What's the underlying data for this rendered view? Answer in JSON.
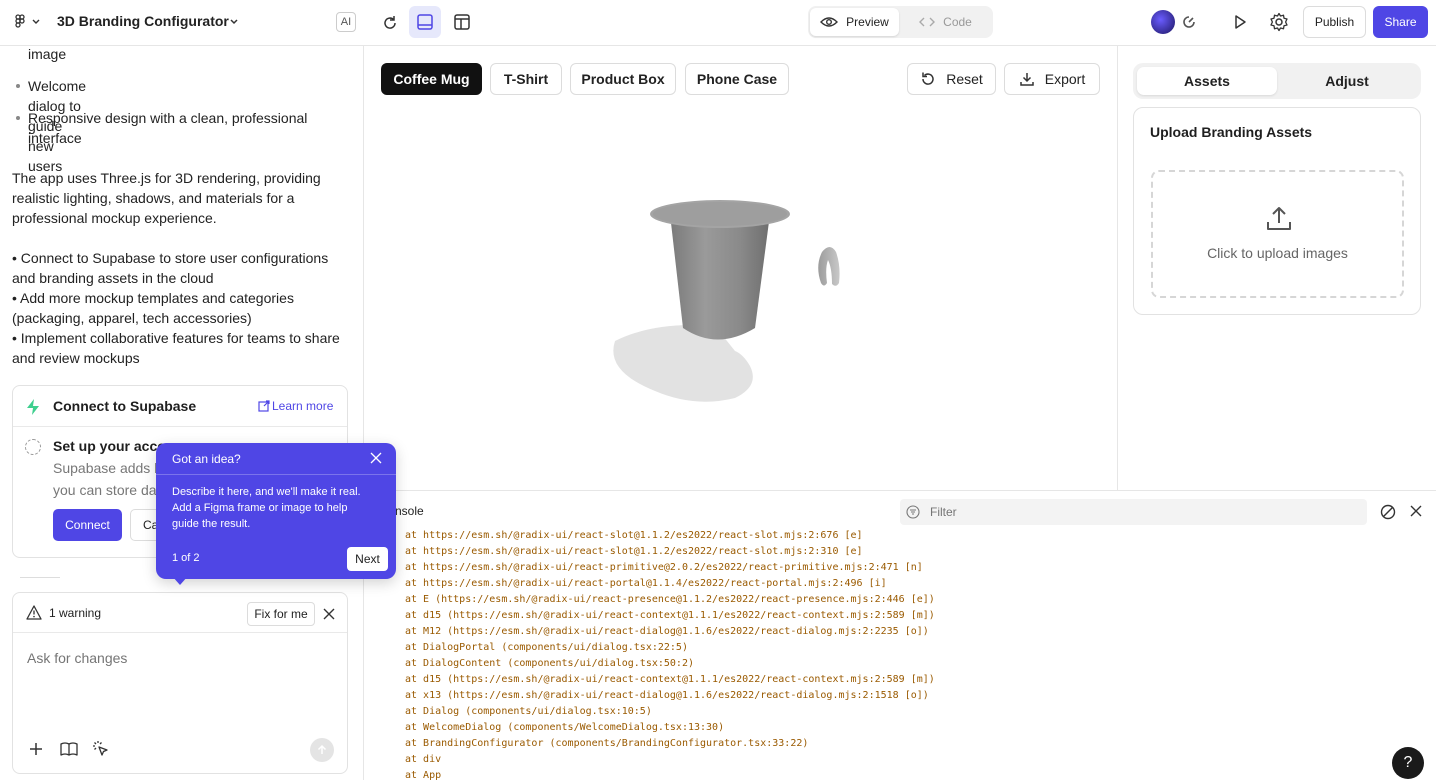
{
  "topbar": {
    "project_title": "3D Branding Configurator",
    "ai_badge": "AI",
    "preview_label": "Preview",
    "code_label": "Code",
    "publish_label": "Publish",
    "share_label": "Share"
  },
  "chat": {
    "top_fragment": "image",
    "bullets": [
      "Welcome dialog to guide new users",
      "Responsive design with a clean, professional",
      "interface"
    ],
    "paragraph_lines": [
      "The app uses Three.js for 3D rendering, providing",
      "realistic lighting, shadows, and materials for a",
      "professional mockup experience."
    ],
    "next_steps_lines": [
      "• Connect to Supabase to store user configurations",
      "and branding assets in the cloud",
      "• Add more mockup templates and categories",
      "(packaging, apparel, tech accessories)",
      "• Implement collaborative features for teams to share",
      "and review mockups"
    ]
  },
  "supabase": {
    "title": "Connect to Supabase",
    "learn_more": "Learn more",
    "step_title": "Set up your accou",
    "step_desc_1": "Supabase adds b",
    "step_desc_2": "you can store da",
    "connect_label": "Connect",
    "cancel_label": "Ca"
  },
  "tooltip": {
    "title": "Got an idea?",
    "body_lines": [
      "Describe it here, and we'll make it real.",
      "Add a Figma frame or image to help",
      "guide the result."
    ],
    "counter": "1 of 2",
    "next_label": "Next"
  },
  "warning": {
    "text": "1 warning",
    "fix_label": "Fix for me",
    "input_placeholder": "Ask for changes"
  },
  "templates": {
    "items": [
      "Coffee Mug",
      "T-Shirt",
      "Product Box",
      "Phone Case"
    ],
    "selected": "Coffee Mug"
  },
  "actions": {
    "reset_label": "Reset",
    "export_label": "Export"
  },
  "side_panel": {
    "tabs": [
      "Assets",
      "Adjust"
    ],
    "active_tab": "Assets",
    "upload_title": "Upload Branding Assets",
    "upload_hint": "Click to upload images"
  },
  "console": {
    "title_fragment": "nsole",
    "filter_placeholder": "Filter",
    "lines": [
      "at https://esm.sh/@radix-ui/react-slot@1.1.2/es2022/react-slot.mjs:2:676 [e]",
      "at https://esm.sh/@radix-ui/react-slot@1.1.2/es2022/react-slot.mjs:2:310 [e]",
      "at https://esm.sh/@radix-ui/react-primitive@2.0.2/es2022/react-primitive.mjs:2:471 [n]",
      "at https://esm.sh/@radix-ui/react-portal@1.1.4/es2022/react-portal.mjs:2:496 [i]",
      "at E (https://esm.sh/@radix-ui/react-presence@1.1.2/es2022/react-presence.mjs:2:446 [e])",
      "at d15 (https://esm.sh/@radix-ui/react-context@1.1.1/es2022/react-context.mjs:2:589 [m])",
      "at M12 (https://esm.sh/@radix-ui/react-dialog@1.1.6/es2022/react-dialog.mjs:2:2235 [o])",
      "at DialogPortal (components/ui/dialog.tsx:22:5)",
      "at DialogContent (components/ui/dialog.tsx:50:2)",
      "at d15 (https://esm.sh/@radix-ui/react-context@1.1.1/es2022/react-context.mjs:2:589 [m])",
      "at x13 (https://esm.sh/@radix-ui/react-dialog@1.1.6/es2022/react-dialog.mjs:2:1518 [o])",
      "at Dialog (components/ui/dialog.tsx:10:5)",
      "at WelcomeDialog (components/WelcomeDialog.tsx:13:30)",
      "at BrandingConfigurator (components/BrandingConfigurator.tsx:33:22)",
      "at div",
      "at App"
    ]
  },
  "help_label": "?",
  "colors": {
    "accent": "#4f46e5",
    "supabase_green": "#3ecf8e",
    "console_text": "#9a5a00",
    "selected_template": "#111111"
  }
}
